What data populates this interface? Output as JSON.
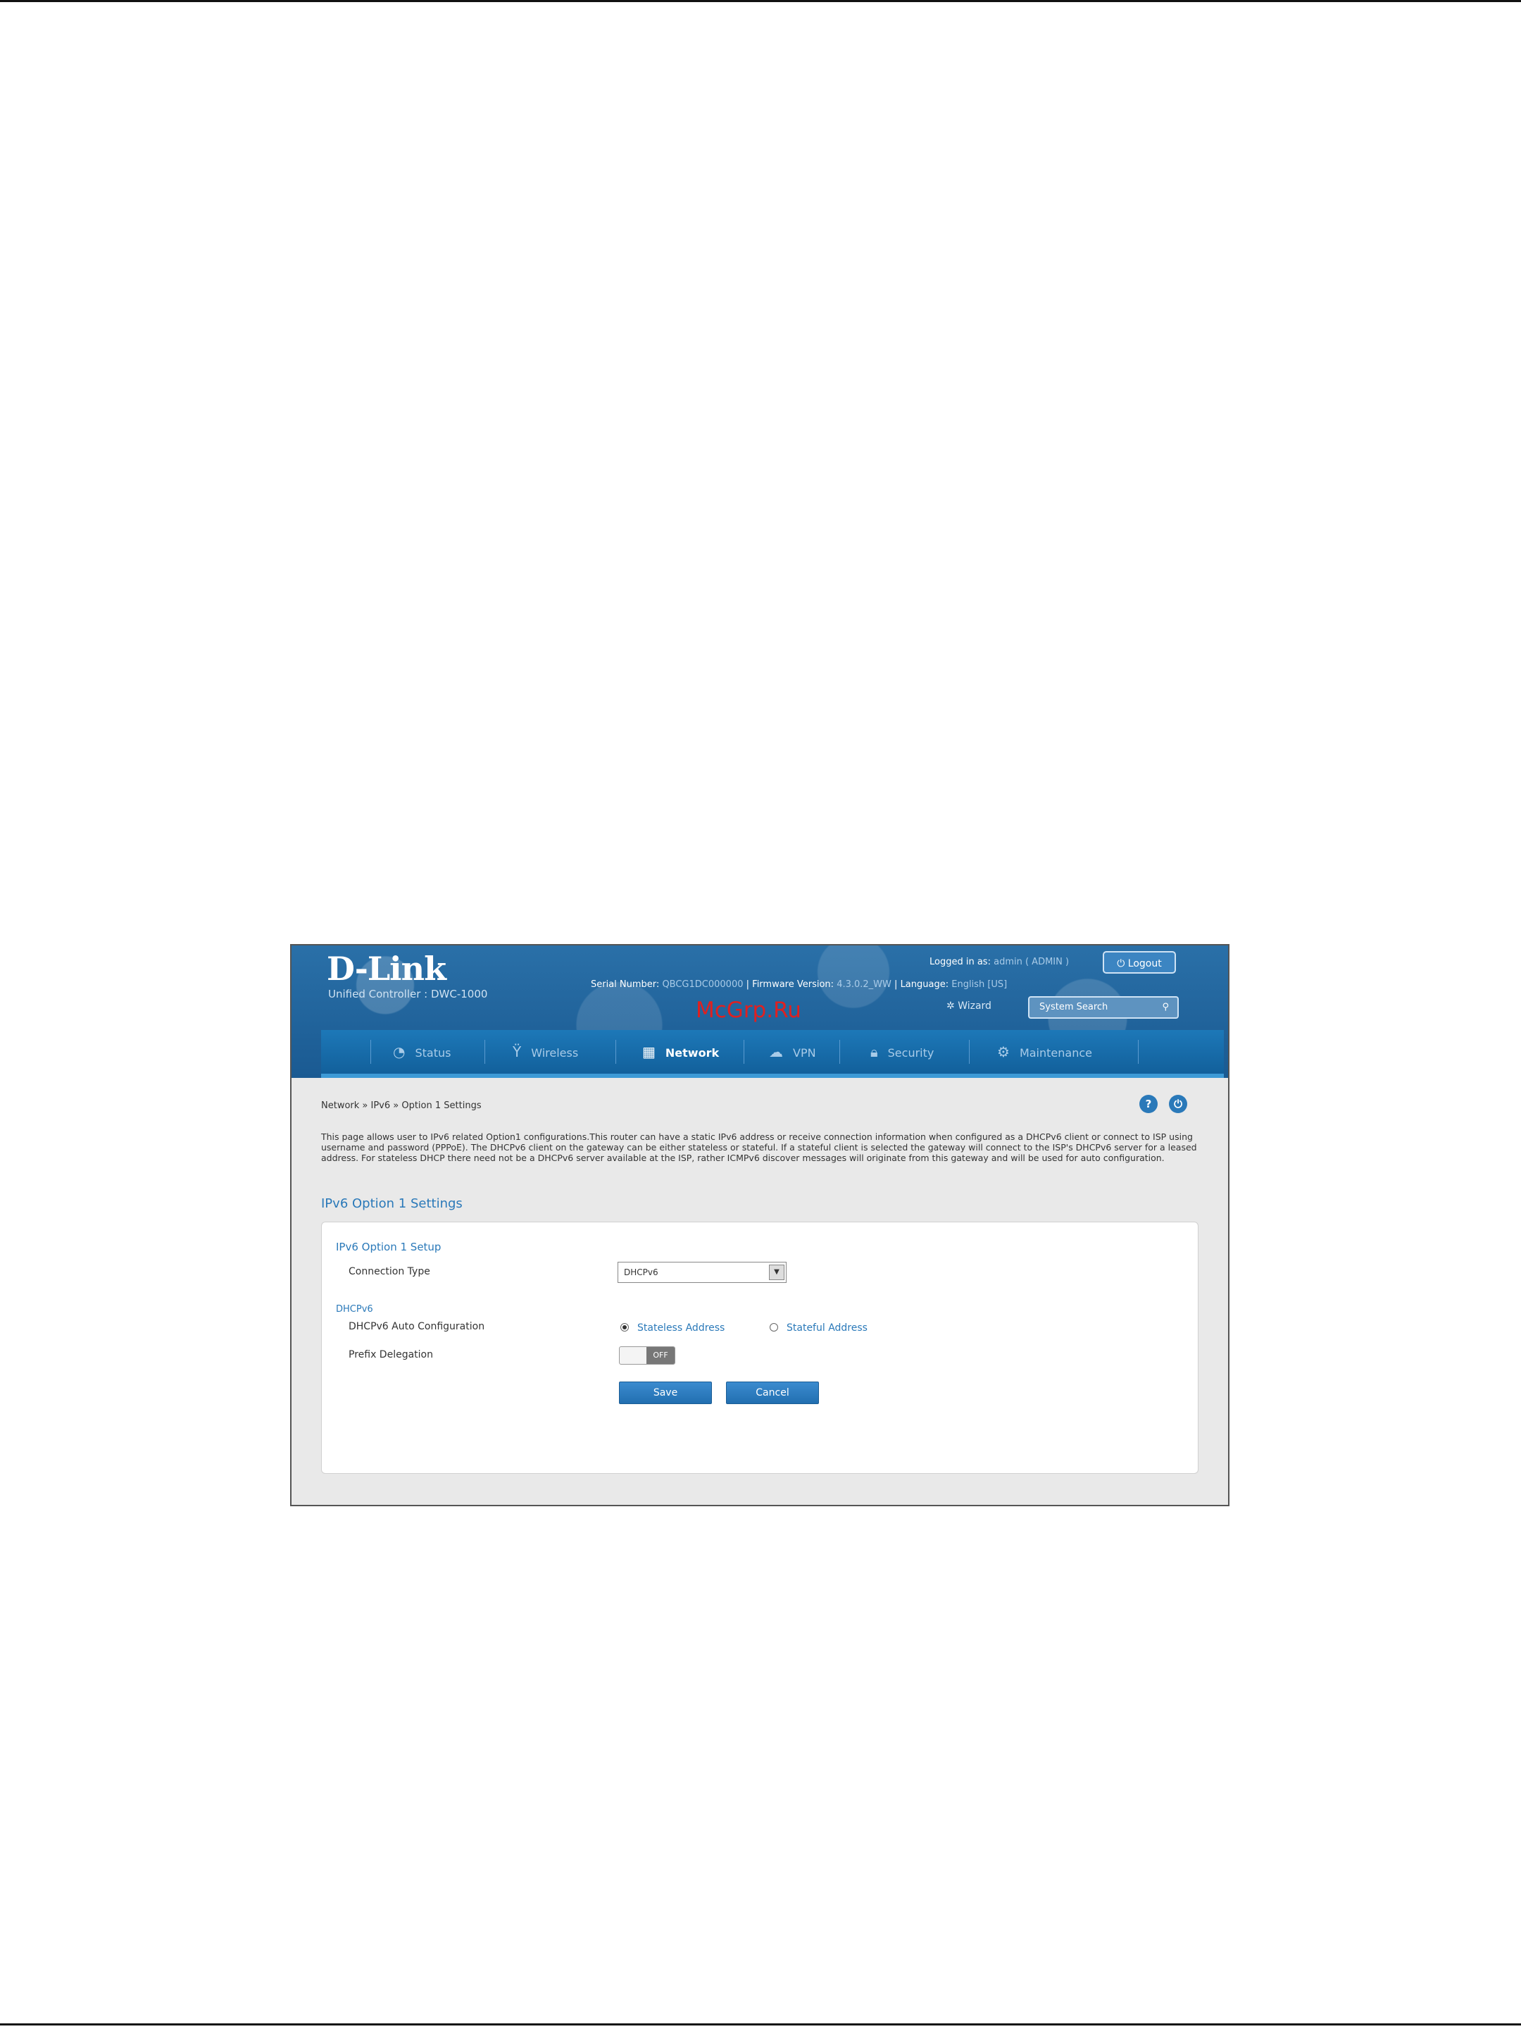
{
  "header": {
    "logo": "D-Link",
    "product": "Unified Controller : DWC-1000",
    "serial_label": "Serial Number:",
    "serial_value": "QBCG1DC000000",
    "firmware_label": "Firmware Version:",
    "firmware_value": "4.3.0.2_WW",
    "language_label": "Language:",
    "language_value": "English [US]",
    "logged_in_label": "Logged in as:",
    "logged_in_value": "admin ( ADMIN )",
    "logout_label": "Logout",
    "wizard_label": "Wizard",
    "search_label": "System Search",
    "watermark": "McGrp.Ru"
  },
  "nav": {
    "items": [
      {
        "label": "Status",
        "icon": "gauge-icon"
      },
      {
        "label": "Wireless",
        "icon": "antenna-icon"
      },
      {
        "label": "Network",
        "icon": "network-icon",
        "active": true
      },
      {
        "label": "VPN",
        "icon": "cloud-icon"
      },
      {
        "label": "Security",
        "icon": "lock-icon"
      },
      {
        "label": "Maintenance",
        "icon": "gear-icon"
      }
    ]
  },
  "breadcrumb": "Network  »  IPv6  »  Option 1 Settings",
  "description": "This page allows user to IPv6 related Option1 configurations.This router can have a static IPv6 address or receive connection information when configured as a DHCPv6 client or connect to ISP using username and password (PPPoE). The DHCPv6 client on the gateway can be either stateless or stateful. If a stateful client is selected the gateway will connect to the ISP's DHCPv6 server for a leased address. For stateless DHCP there need not be a DHCPv6 server available at the ISP, rather ICMPv6 discover messages will originate from this gateway and will be used for auto configuration.",
  "section_title": "IPv6 Option 1 Settings",
  "form": {
    "setup_title": "IPv6 Option 1 Setup",
    "connection_type_label": "Connection Type",
    "connection_type_value": "DHCPv6",
    "dhcp_title": "DHCPv6",
    "auto_config_label": "DHCPv6 Auto Configuration",
    "radio_stateless": "Stateless Address",
    "radio_stateful": "Stateful Address",
    "prefix_label": "Prefix Delegation",
    "toggle_state": "OFF",
    "save_label": "Save",
    "cancel_label": "Cancel"
  }
}
